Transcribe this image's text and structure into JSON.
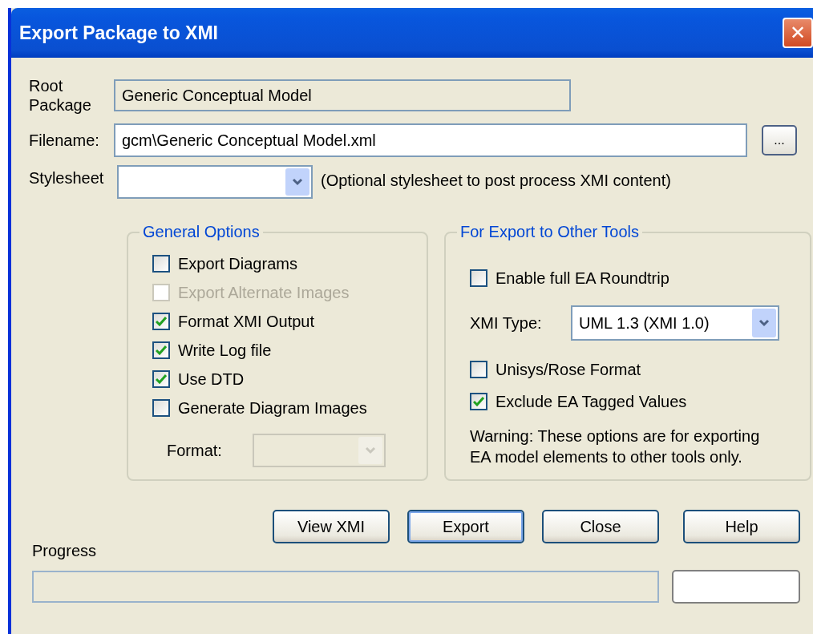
{
  "window": {
    "title": "Export Package to XMI",
    "close_icon": "✕"
  },
  "root_package": {
    "label": "Root\nPackage",
    "value": "Generic Conceptual Model"
  },
  "filename": {
    "label": "Filename:",
    "value": "gcm\\Generic Conceptual Model.xml",
    "browse": "..."
  },
  "stylesheet": {
    "label": "Stylesheet",
    "hint": "(Optional stylesheet to post process XMI content)"
  },
  "general_options": {
    "title": "General Options",
    "checkboxes": [
      {
        "label": "Export Diagrams",
        "checked": false,
        "disabled": false
      },
      {
        "label": "Export Alternate Images",
        "checked": false,
        "disabled": true
      },
      {
        "label": "Format XMI Output",
        "checked": true,
        "disabled": false
      },
      {
        "label": "Write Log file",
        "checked": true,
        "disabled": false
      },
      {
        "label": "Use DTD",
        "checked": true,
        "disabled": false
      },
      {
        "label": "Generate Diagram Images",
        "checked": false,
        "disabled": false
      }
    ],
    "format": {
      "label": "Format:",
      "disabled": true
    }
  },
  "other_tools": {
    "title": "For Export to Other Tools",
    "items": [
      {
        "kind": "checkbox",
        "label": "Enable full EA Roundtrip",
        "checked": false
      },
      {
        "kind": "select",
        "label": "XMI Type:",
        "value": "UML 1.3 (XMI 1.0)"
      },
      {
        "kind": "checkbox",
        "label": "Unisys/Rose Format",
        "checked": false
      },
      {
        "kind": "checkbox",
        "label": "Exclude EA Tagged Values",
        "checked": true
      },
      {
        "kind": "note",
        "label": "Warning: These options are for exporting EA model elements to other tools only."
      }
    ]
  },
  "buttons": [
    {
      "label": "View XMI",
      "focused": false
    },
    {
      "label": "Export",
      "focused": true
    },
    {
      "label": "Close",
      "focused": false
    },
    {
      "label": "Help",
      "focused": false
    }
  ],
  "progress": {
    "label": "Progress"
  }
}
